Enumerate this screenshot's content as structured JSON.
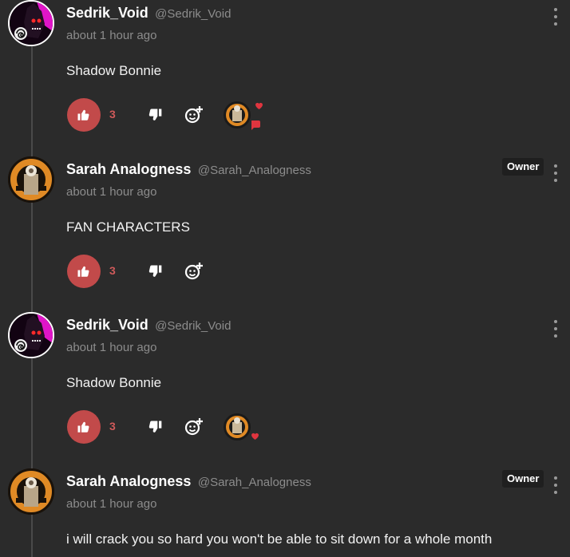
{
  "comments": [
    {
      "display_name": "Sedrik_Void",
      "handle": "@Sedrik_Void",
      "timestamp": "about 1 hour ago",
      "text": "Shadow Bonnie",
      "likes": "3",
      "owner_badge": "",
      "avatar": "sedrik-void-avatar",
      "reactions": [
        "heart",
        "speech"
      ]
    },
    {
      "display_name": "Sarah Analogness",
      "handle": "@Sarah_Analogness",
      "timestamp": "about 1 hour ago",
      "text": "FAN CHARACTERS",
      "likes": "3",
      "owner_badge": "Owner",
      "avatar": "sarah-analogness-avatar",
      "reactions": []
    },
    {
      "display_name": "Sedrik_Void",
      "handle": "@Sedrik_Void",
      "timestamp": "about 1 hour ago",
      "text": "Shadow Bonnie",
      "likes": "3",
      "owner_badge": "",
      "avatar": "sedrik-void-avatar",
      "reactions": [
        "heart"
      ]
    },
    {
      "display_name": "Sarah Analogness",
      "handle": "@Sarah_Analogness",
      "timestamp": "about 1 hour ago",
      "text": "i will crack you so hard you won't be able to sit down for a whole month",
      "likes": "",
      "owner_badge": "Owner",
      "avatar": "sarah-analogness-avatar",
      "reactions": []
    }
  ],
  "colors": {
    "background": "#2b2b2b",
    "like_accent": "#c24a4a",
    "muted_text": "#8c8c8c",
    "owner_badge_bg": "#1f1f1f"
  },
  "icons": {
    "like": "thumbs-up-icon",
    "dislike": "thumbs-down-icon",
    "add_reaction": "add-reaction-icon",
    "menu": "more-vertical-icon"
  }
}
